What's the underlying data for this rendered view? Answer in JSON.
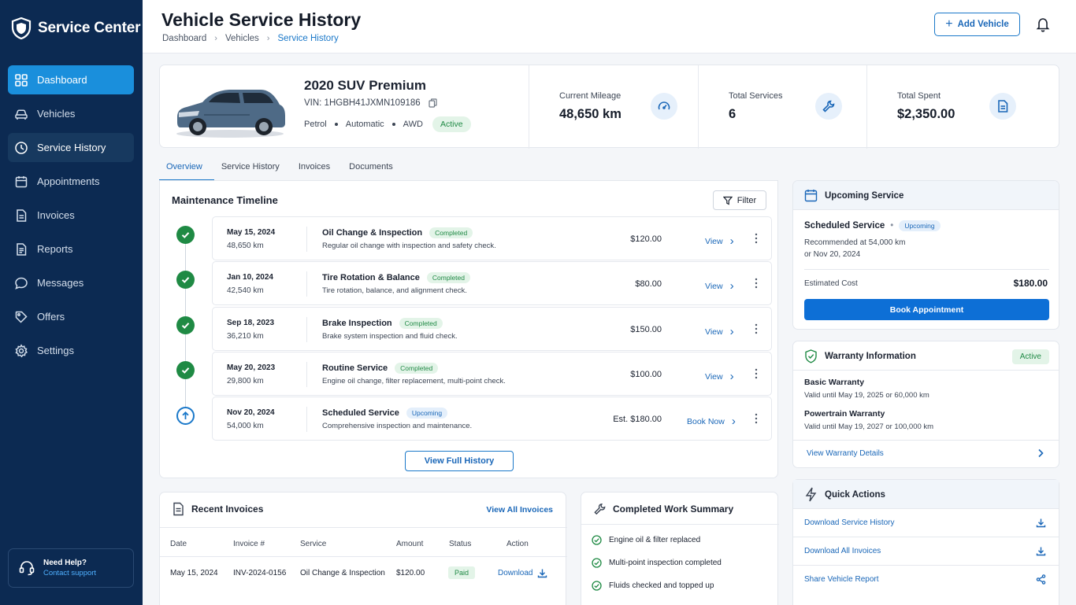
{
  "brand": {
    "name": "Service Center"
  },
  "sidebar": {
    "items": [
      {
        "label": "Dashboard",
        "icon": "grid-icon"
      },
      {
        "label": "Vehicles",
        "icon": "car-icon"
      },
      {
        "label": "Service History",
        "icon": "clock-icon"
      },
      {
        "label": "Appointments",
        "icon": "calendar-icon"
      },
      {
        "label": "Invoices",
        "icon": "document-icon"
      },
      {
        "label": "Reports",
        "icon": "report-icon"
      },
      {
        "label": "Messages",
        "icon": "chat-icon"
      },
      {
        "label": "Offers",
        "icon": "tag-icon"
      },
      {
        "label": "Settings",
        "icon": "gear-icon"
      }
    ],
    "help": {
      "title": "Need Help?",
      "link": "Contact support"
    }
  },
  "header": {
    "title": "Vehicle Service History",
    "breadcrumb": [
      "Dashboard",
      "Vehicles",
      "Service History"
    ],
    "add_button": "Add Vehicle"
  },
  "vehicle": {
    "name": "2020 SUV Premium",
    "vin": "VIN: 1HGBH41JXMN109186",
    "specs": [
      "Petrol",
      "Automatic",
      "AWD"
    ],
    "status": "Active",
    "stats": [
      {
        "label": "Current Mileage",
        "value": "48,650 km"
      },
      {
        "label": "Total Services",
        "value": "6"
      },
      {
        "label": "Total Spent",
        "value": "$2,350.00"
      }
    ]
  },
  "tabs": [
    "Overview",
    "Service History",
    "Invoices",
    "Documents"
  ],
  "timeline": {
    "title": "Maintenance Timeline",
    "filter": "Filter",
    "rows": [
      {
        "date": "May 15, 2024",
        "km": "48,650 km",
        "service": "Oil Change & Inspection",
        "status": "Completed",
        "desc": "Regular oil change with inspection and safety check.",
        "amount": "$120.00",
        "action": "View"
      },
      {
        "date": "Jan 10, 2024",
        "km": "42,540 km",
        "service": "Tire Rotation & Balance",
        "status": "Completed",
        "desc": "Tire rotation, balance, and alignment check.",
        "amount": "$80.00",
        "action": "View"
      },
      {
        "date": "Sep 18, 2023",
        "km": "36,210 km",
        "service": "Brake Inspection",
        "status": "Completed",
        "desc": "Brake system inspection and fluid check.",
        "amount": "$150.00",
        "action": "View"
      },
      {
        "date": "May 20, 2023",
        "km": "29,800 km",
        "service": "Routine Service",
        "status": "Completed",
        "desc": "Engine oil change, filter replacement, multi-point check.",
        "amount": "$100.00",
        "action": "View"
      },
      {
        "date": "Nov 20, 2024",
        "km": "54,000 km",
        "service": "Scheduled Service",
        "status": "Upcoming",
        "desc": "Comprehensive inspection and maintenance.",
        "amount": "Est. $180.00",
        "action": "Book Now"
      }
    ],
    "full_history": "View Full History"
  },
  "invoices": {
    "title": "Recent Invoices",
    "view_all": "View All Invoices",
    "columns": [
      "Date",
      "Invoice #",
      "Service",
      "Amount",
      "Status",
      "Action"
    ],
    "rows": [
      {
        "date": "May 15, 2024",
        "number": "INV-2024-0156",
        "service": "Oil Change & Inspection",
        "amount": "$120.00",
        "status": "Paid",
        "action": "Download"
      }
    ]
  },
  "work_summary": {
    "title": "Completed Work Summary",
    "items": [
      "Engine oil & filter replaced",
      "Multi-point inspection completed",
      "Fluids checked and topped up"
    ]
  },
  "upcoming": {
    "title": "Upcoming Service",
    "name": "Scheduled Service",
    "separator": "•",
    "status": "Upcoming",
    "line1": "Recommended at 54,000 km",
    "line2": "or Nov 20, 2024",
    "cost_label": "Estimated Cost",
    "cost_value": "$180.00",
    "book_button": "Book Appointment"
  },
  "warranty": {
    "title": "Warranty Information",
    "status": "Active",
    "items": [
      {
        "name": "Basic Warranty",
        "detail": "Valid until May 19, 2025 or 60,000 km"
      },
      {
        "name": "Powertrain Warranty",
        "detail": "Valid until May 19, 2027 or 100,000 km"
      }
    ],
    "link": "View Warranty Details"
  },
  "quick_actions": {
    "title": "Quick Actions",
    "items": [
      "Download Service History",
      "Download All Invoices",
      "Share Vehicle Report"
    ]
  },
  "colors": {
    "sidebar": "#0c2a52",
    "accent": "#1a78c9",
    "success": "#1f8a44"
  }
}
